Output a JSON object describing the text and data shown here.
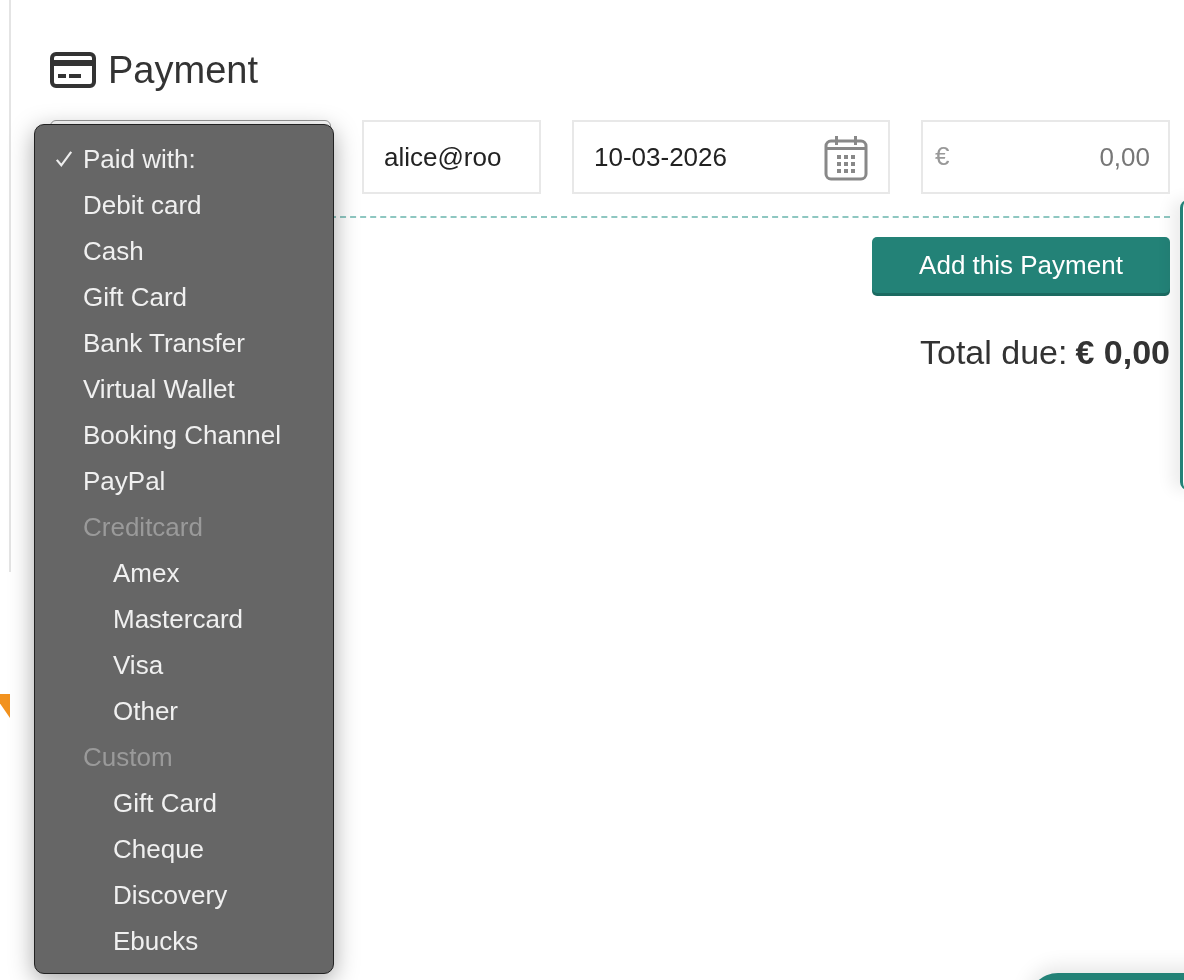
{
  "section": {
    "title": "Payment"
  },
  "form": {
    "method_select": {
      "expanded": true
    },
    "email": {
      "value": "alice@roo"
    },
    "date": {
      "value": "10-03-2026"
    },
    "amount": {
      "currency": "€",
      "placeholder": "0,00"
    }
  },
  "menu": {
    "options": [
      {
        "kind": "option",
        "label": "Paid with:",
        "selected": true
      },
      {
        "kind": "option",
        "label": "Debit card",
        "selected": false
      },
      {
        "kind": "option",
        "label": "Cash",
        "selected": false
      },
      {
        "kind": "option",
        "label": "Gift Card",
        "selected": false
      },
      {
        "kind": "option",
        "label": "Bank Transfer",
        "selected": false
      },
      {
        "kind": "option",
        "label": "Virtual Wallet",
        "selected": false
      },
      {
        "kind": "option",
        "label": "Booking Channel",
        "selected": false
      },
      {
        "kind": "option",
        "label": "PayPal",
        "selected": false
      },
      {
        "kind": "group",
        "label": "Creditcard",
        "children": [
          {
            "label": "Amex",
            "selected": false
          },
          {
            "label": "Mastercard",
            "selected": false
          },
          {
            "label": "Visa",
            "selected": false
          },
          {
            "label": "Other",
            "selected": false
          }
        ]
      },
      {
        "kind": "group",
        "label": "Custom",
        "children": [
          {
            "label": "Gift Card",
            "selected": false
          },
          {
            "label": "Cheque",
            "selected": false
          },
          {
            "label": "Discovery",
            "selected": false
          },
          {
            "label": "Ebucks",
            "selected": false
          }
        ]
      }
    ]
  },
  "add_button": {
    "label": "Add this Payment"
  },
  "total": {
    "label": "Total due:",
    "value": "€ 0,00"
  }
}
